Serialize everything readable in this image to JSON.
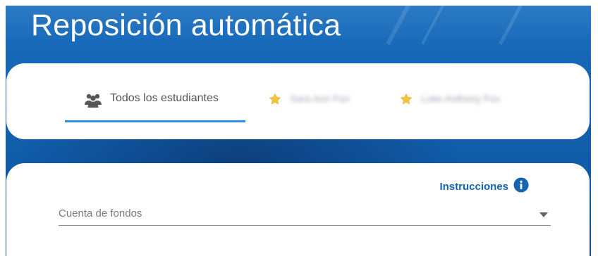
{
  "page": {
    "title": "Reposición automática"
  },
  "tabs": [
    {
      "label": "Todos los estudiantes",
      "icon": "people-icon",
      "active": true
    },
    {
      "label": "Sara Ann Fox",
      "icon": "star-icon",
      "active": false,
      "redacted": true
    },
    {
      "label": "Luke Anthony Fox",
      "icon": "star-icon",
      "active": false,
      "redacted": true
    }
  ],
  "form": {
    "instructions_label": "Instrucciones",
    "instructions_icon": "info-icon",
    "fund_account": {
      "label": "Cuenta de fondos",
      "value": ""
    }
  },
  "colors": {
    "background_blue": "#1464b2",
    "accent": "#2f8fe0",
    "link": "#1464b2",
    "star": "#f3c43a"
  }
}
